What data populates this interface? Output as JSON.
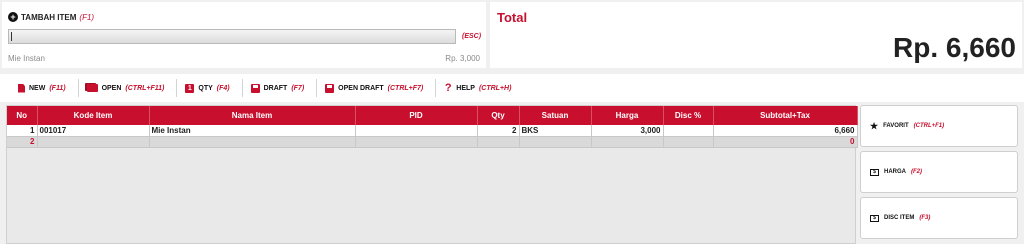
{
  "add_item": {
    "title": "TAMBAH ITEM",
    "shortcut": "(F1)",
    "esc_hint": "(ESC)",
    "last_item_name": "Mie Instan",
    "last_item_price": "Rp. 3,000",
    "search_value": ""
  },
  "total": {
    "label": "Total",
    "value": "Rp. 6,660"
  },
  "toolbar": {
    "new_label": "NEW",
    "new_key": "(F11)",
    "open_label": "OPEN",
    "open_key": "(CTRL+F11)",
    "qty_label": "QTY",
    "qty_key": "(F4)",
    "qty_icon_text": "1",
    "draft_label": "DRAFT",
    "draft_key": "(F7)",
    "open_draft_label": "OPEN DRAFT",
    "open_draft_key": "(CTRL+F7)",
    "help_label": "HELP",
    "help_key": "(CTRL+H)",
    "help_icon_text": "?"
  },
  "grid": {
    "headers": {
      "no": "No",
      "kode": "Kode Item",
      "nama": "Nama Item",
      "pid": "PID",
      "qty": "Qty",
      "satuan": "Satuan",
      "harga": "Harga",
      "disc": "Disc %",
      "subtotal": "Subtotal+Tax"
    },
    "rows": [
      {
        "no": "1",
        "kode": "001017",
        "nama": "Mie Instan",
        "pid": "",
        "qty": "2",
        "satuan": "BKS",
        "harga": "3,000",
        "disc": "",
        "subtotal": "6,660"
      },
      {
        "no": "2",
        "kode": "",
        "nama": "",
        "pid": "",
        "qty": "",
        "satuan": "",
        "harga": "",
        "disc": "",
        "subtotal": "0"
      }
    ]
  },
  "side_buttons": {
    "favorit_label": "FAVORIT",
    "favorit_key": "(CTRL+F1)",
    "harga_label": "HARGA",
    "harga_key": "(F2)",
    "disc_label": "DISC ITEM",
    "disc_key": "(F3)",
    "money_icon_text": "$"
  },
  "icons": {
    "plus": "plus-circle-icon",
    "new": "new-document-icon",
    "open": "open-folder-icon",
    "qty": "quantity-icon",
    "draft": "save-draft-icon",
    "open_draft": "open-draft-icon",
    "help": "question-icon",
    "favorit": "star-icon",
    "harga": "money-icon",
    "disc": "money-icon"
  },
  "colors": {
    "accent": "#c8102e",
    "text": "#222222"
  }
}
